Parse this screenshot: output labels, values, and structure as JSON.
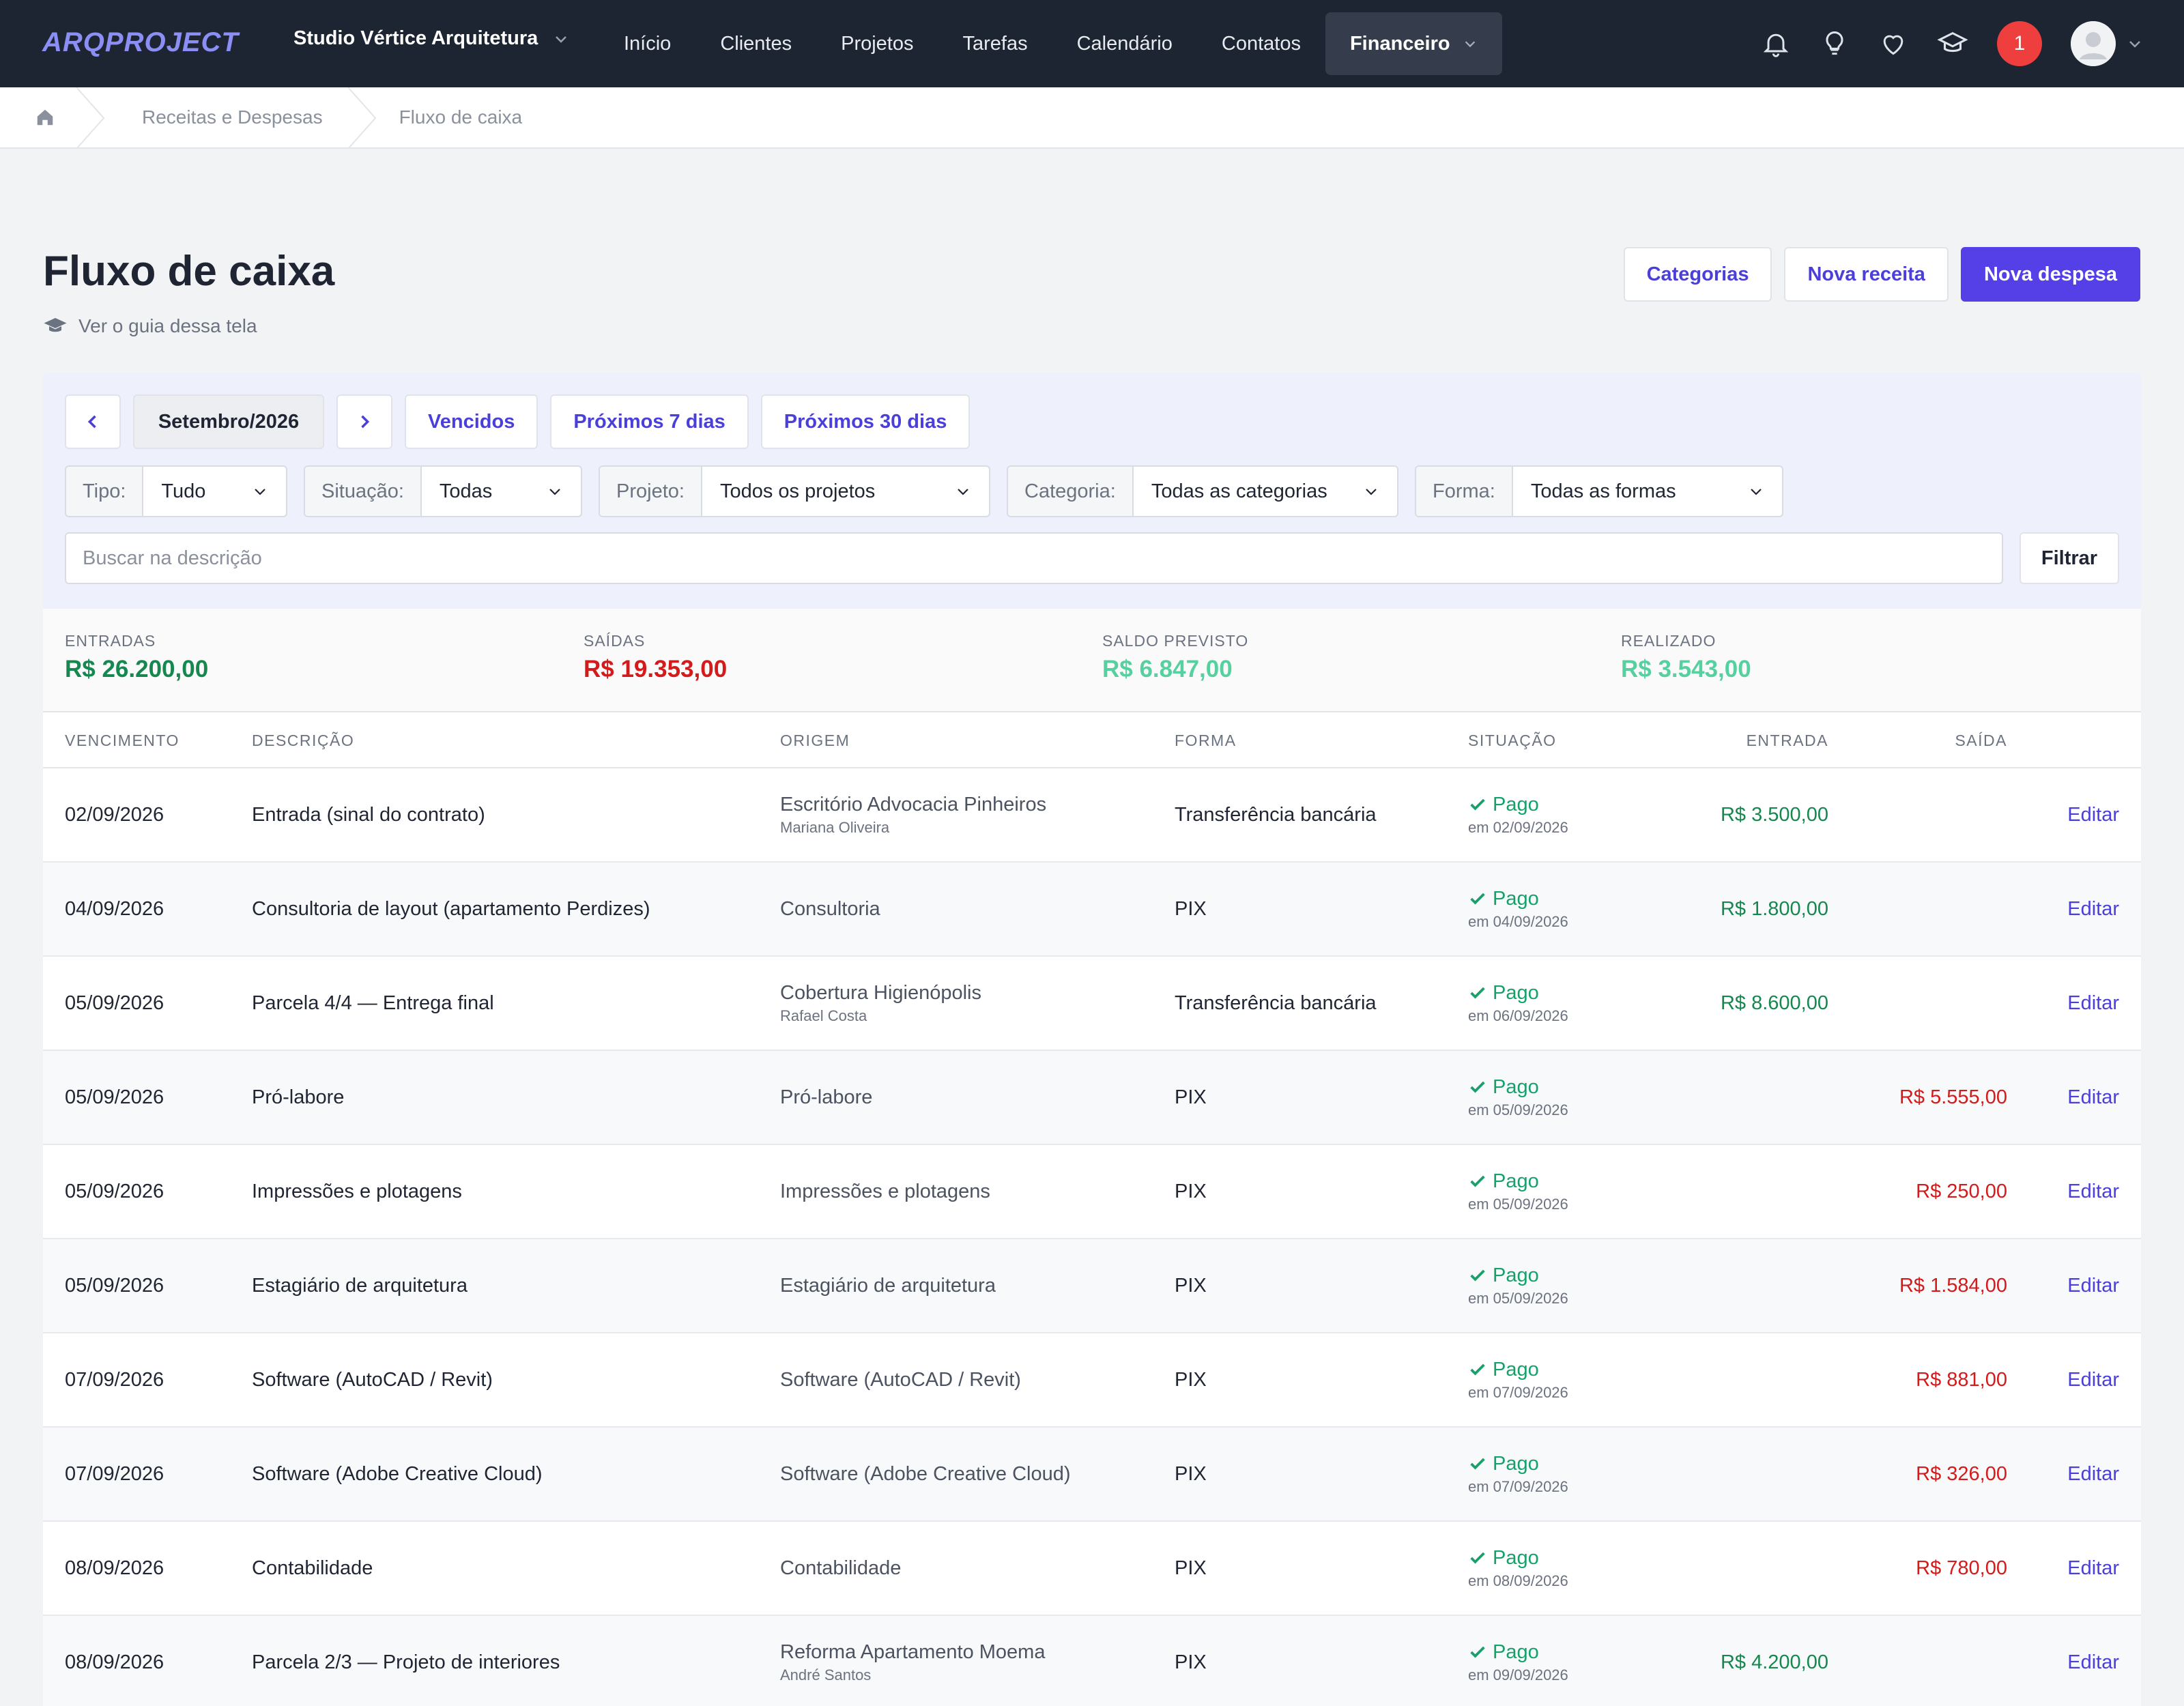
{
  "nav": {
    "logo": "ARQPROJECT",
    "studio": "Studio Vértice Arquitetura",
    "items": [
      "Início",
      "Clientes",
      "Projetos",
      "Tarefas",
      "Calendário",
      "Contatos"
    ],
    "active_item": "Financeiro",
    "notification_count": "1"
  },
  "breadcrumb": [
    "Receitas e Despesas",
    "Fluxo de caixa"
  ],
  "header": {
    "title": "Fluxo de caixa",
    "guide": "Ver o guia dessa tela",
    "buttons": {
      "categories": "Categorias",
      "new_income": "Nova receita",
      "new_expense": "Nova despesa"
    }
  },
  "period": {
    "month": "Setembro/2026",
    "overdue": "Vencidos",
    "next7": "Próximos 7 dias",
    "next30": "Próximos 30 dias"
  },
  "filters": {
    "tipo": {
      "label": "Tipo:",
      "value": "Tudo"
    },
    "situacao": {
      "label": "Situação:",
      "value": "Todas"
    },
    "projeto": {
      "label": "Projeto:",
      "value": "Todos os projetos"
    },
    "categoria": {
      "label": "Categoria:",
      "value": "Todas as categorias"
    },
    "forma": {
      "label": "Forma:",
      "value": "Todas as formas"
    },
    "search_placeholder": "Buscar na descrição",
    "filter_button": "Filtrar"
  },
  "summary": {
    "entradas": {
      "label": "ENTRADAS",
      "value": "R$ 26.200,00"
    },
    "saidas": {
      "label": "SAÍDAS",
      "value": "R$ 19.353,00"
    },
    "saldo": {
      "label": "SALDO PREVISTO",
      "value": "R$ 6.847,00"
    },
    "realizado": {
      "label": "REALIZADO",
      "value": "R$ 3.543,00"
    }
  },
  "colors": {
    "income": "#16874f",
    "expense": "#d41b1b",
    "accent": "#5440e6",
    "paid": "#18a06b",
    "saldo": "#57d0a0"
  },
  "table": {
    "headers": {
      "vencimento": "VENCIMENTO",
      "descricao": "DESCRIÇÃO",
      "origem": "ORIGEM",
      "forma": "FORMA",
      "situacao": "SITUAÇÃO",
      "entrada": "ENTRADA",
      "saida": "SAÍDA"
    },
    "edit_label": "Editar",
    "rows": [
      {
        "date": "02/09/2026",
        "desc": "Entrada (sinal do contrato)",
        "origin": "Escritório Advocacia Pinheiros",
        "origin_sub": "Mariana Oliveira",
        "form": "Transferência bancária",
        "status": "Pago",
        "status_date": "em 02/09/2026",
        "in": "R$ 3.500,00",
        "out": ""
      },
      {
        "date": "04/09/2026",
        "desc": "Consultoria de layout (apartamento Perdizes)",
        "origin": "Consultoria",
        "origin_sub": "",
        "form": "PIX",
        "status": "Pago",
        "status_date": "em 04/09/2026",
        "in": "R$ 1.800,00",
        "out": ""
      },
      {
        "date": "05/09/2026",
        "desc": "Parcela 4/4 — Entrega final",
        "origin": "Cobertura Higienópolis",
        "origin_sub": "Rafael Costa",
        "form": "Transferência bancária",
        "status": "Pago",
        "status_date": "em 06/09/2026",
        "in": "R$ 8.600,00",
        "out": ""
      },
      {
        "date": "05/09/2026",
        "desc": "Pró-labore",
        "origin": "Pró-labore",
        "origin_sub": "",
        "form": "PIX",
        "status": "Pago",
        "status_date": "em 05/09/2026",
        "in": "",
        "out": "R$ 5.555,00"
      },
      {
        "date": "05/09/2026",
        "desc": "Impressões e plotagens",
        "origin": "Impressões e plotagens",
        "origin_sub": "",
        "form": "PIX",
        "status": "Pago",
        "status_date": "em 05/09/2026",
        "in": "",
        "out": "R$ 250,00"
      },
      {
        "date": "05/09/2026",
        "desc": "Estagiário de arquitetura",
        "origin": "Estagiário de arquitetura",
        "origin_sub": "",
        "form": "PIX",
        "status": "Pago",
        "status_date": "em 05/09/2026",
        "in": "",
        "out": "R$ 1.584,00"
      },
      {
        "date": "07/09/2026",
        "desc": "Software (AutoCAD / Revit)",
        "origin": "Software (AutoCAD / Revit)",
        "origin_sub": "",
        "form": "PIX",
        "status": "Pago",
        "status_date": "em 07/09/2026",
        "in": "",
        "out": "R$ 881,00"
      },
      {
        "date": "07/09/2026",
        "desc": "Software (Adobe Creative Cloud)",
        "origin": "Software (Adobe Creative Cloud)",
        "origin_sub": "",
        "form": "PIX",
        "status": "Pago",
        "status_date": "em 07/09/2026",
        "in": "",
        "out": "R$ 326,00"
      },
      {
        "date": "08/09/2026",
        "desc": "Contabilidade",
        "origin": "Contabilidade",
        "origin_sub": "",
        "form": "PIX",
        "status": "Pago",
        "status_date": "em 08/09/2026",
        "in": "",
        "out": "R$ 780,00"
      },
      {
        "date": "08/09/2026",
        "desc": "Parcela 2/3 — Projeto de interiores",
        "origin": "Reforma Apartamento Moema",
        "origin_sub": "André Santos",
        "form": "PIX",
        "status": "Pago",
        "status_date": "em 09/09/2026",
        "in": "R$ 4.200,00",
        "out": ""
      }
    ]
  }
}
